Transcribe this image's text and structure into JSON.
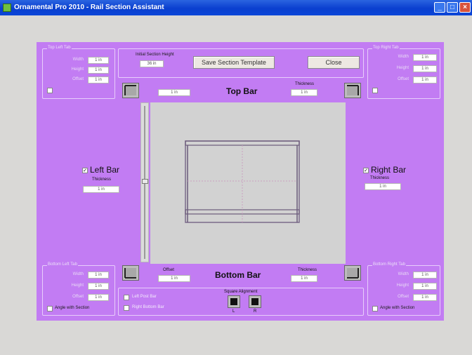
{
  "window": {
    "title": "Ornamental Pro 2010 - Rail Section Assistant",
    "minimize": "_",
    "maximize": "□",
    "close": "×"
  },
  "top_left_tab": {
    "title": "Top Left Tab",
    "labels": [
      "Width",
      "Height",
      "Offset"
    ],
    "values": [
      "1 in",
      "1 in",
      "1 in"
    ]
  },
  "top_right_tab": {
    "title": "Top Right Tab",
    "labels": [
      "Width",
      "Height",
      "Offset"
    ],
    "values": [
      "1 in",
      "1 in",
      "1 in"
    ]
  },
  "bottom_left_tab": {
    "title": "Bottom Left Tab",
    "labels": [
      "Width",
      "Height",
      "Offset"
    ],
    "values": [
      "1 in",
      "1 in",
      "1 in"
    ],
    "angle_label": "Angle with Section"
  },
  "bottom_right_tab": {
    "title": "Bottom Right Tab",
    "labels": [
      "Width",
      "Height",
      "Offset"
    ],
    "values": [
      "1 in",
      "1 in",
      "1 in"
    ],
    "angle_label": "Angle with Section"
  },
  "header": {
    "initial_height_label": "Initial Section Height",
    "initial_height_value": "36 in",
    "save_label": "Save Section Template",
    "close_label": "Close"
  },
  "top_bar": {
    "label": "Top Bar",
    "offset_value": "1 in",
    "thickness_label": "Thickness",
    "thickness_value": "1 in"
  },
  "bottom_bar": {
    "label": "Bottom Bar",
    "offset_label": "Offset",
    "offset_value": "1 in",
    "thickness_label": "Thickness",
    "thickness_value": "1 in"
  },
  "left_bar": {
    "label": "Left Bar",
    "checked": "✓",
    "thickness_label": "Thickness",
    "thickness_value": "1 in"
  },
  "right_bar": {
    "label": "Right Bar",
    "checked": "✓",
    "thickness_label": "Thickness",
    "thickness_value": "1 in"
  },
  "options": {
    "left_post_label": "Left Post Bar",
    "right_bottom_label": "Right Bottom Bar",
    "square_alignment_label": "Square Alignment",
    "left_letter": "L",
    "right_letter": "R"
  },
  "colors": {
    "panel": "#c27cf3",
    "canvas": "#d2d2d2",
    "titlebar": "#0a3fcf"
  }
}
